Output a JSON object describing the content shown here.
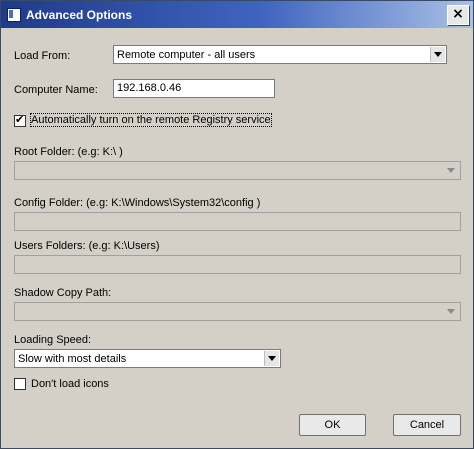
{
  "window": {
    "title": "Advanced Options",
    "close_glyph": "×"
  },
  "form": {
    "load_from": {
      "label": "Load From:",
      "selected": "Remote computer - all users"
    },
    "computer_name": {
      "label": "Computer Name:",
      "value": "192.168.0.46"
    },
    "auto_registry": {
      "label": "Automatically turn on the remote Registry service",
      "checked": true,
      "check_glyph": "✔"
    },
    "root_folder": {
      "label": "Root Folder: (e.g: K:\\ )",
      "value": ""
    },
    "config_folder": {
      "label": "Config Folder: (e.g: K:\\Windows\\System32\\config )",
      "value": ""
    },
    "users_folders": {
      "label": "Users Folders: (e.g: K:\\Users)",
      "value": ""
    },
    "shadow_copy_path": {
      "label": "Shadow Copy Path:",
      "value": ""
    },
    "loading_speed": {
      "label": "Loading Speed:",
      "selected": "Slow with most details"
    },
    "dont_load_icons": {
      "label": "Don't load icons",
      "checked": false
    }
  },
  "buttons": {
    "ok": "OK",
    "cancel": "Cancel"
  },
  "colors": {
    "dialog_bg": "#d4d0c8",
    "titlebar_start": "#1f3a8a",
    "titlebar_end": "#a9c0e6"
  }
}
